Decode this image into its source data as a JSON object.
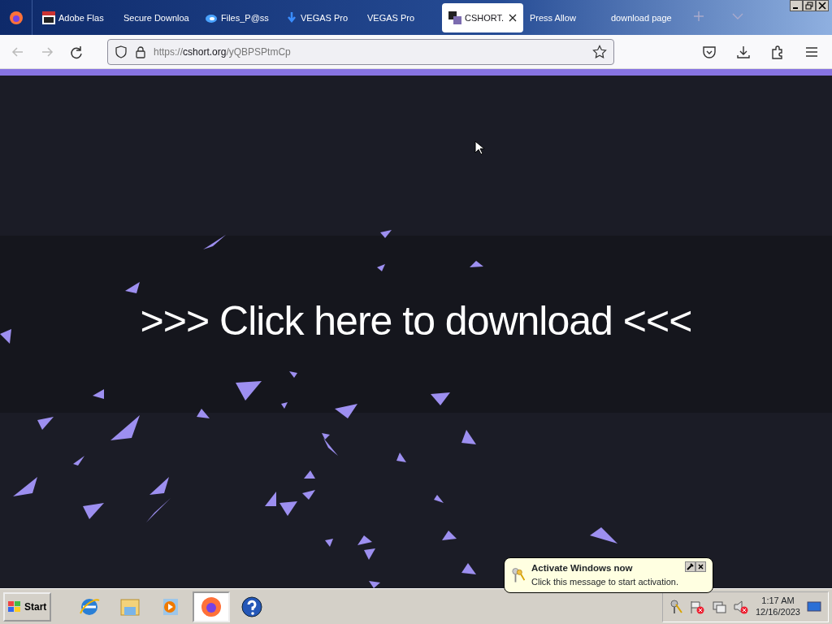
{
  "tabs": [
    {
      "label": "Adobe Flas",
      "kind": "fp",
      "selected": false
    },
    {
      "label": "Secure Downloa",
      "kind": "plain",
      "selected": false
    },
    {
      "label": "Files_P@ss",
      "kind": "cloud",
      "selected": false
    },
    {
      "label": "VEGAS Pro",
      "kind": "download",
      "selected": false
    },
    {
      "label": "VEGAS Pro",
      "kind": "plain",
      "selected": false
    },
    {
      "label": "CSHORT.",
      "kind": "squares",
      "selected": true
    },
    {
      "label": "Press Allow",
      "kind": "plain",
      "selected": false
    },
    {
      "label": "download page",
      "kind": "plain",
      "selected": false
    }
  ],
  "address_bar": {
    "scheme": "https://",
    "domain": "cshort.org",
    "path": "/yQBPSPtmCp"
  },
  "page": {
    "headline": ">>> Click here to download <<<"
  },
  "taskbar": {
    "start_label": "Start",
    "apps": [
      {
        "kind": "ie",
        "selected": false
      },
      {
        "kind": "explorer",
        "selected": false
      },
      {
        "kind": "media",
        "selected": false
      },
      {
        "kind": "firefox",
        "selected": true
      },
      {
        "kind": "help",
        "selected": false
      }
    ],
    "clock": {
      "time": "1:17 AM",
      "date": "12/16/2023"
    }
  },
  "notification": {
    "title": "Activate Windows now",
    "message": "Click this message to start activation."
  }
}
